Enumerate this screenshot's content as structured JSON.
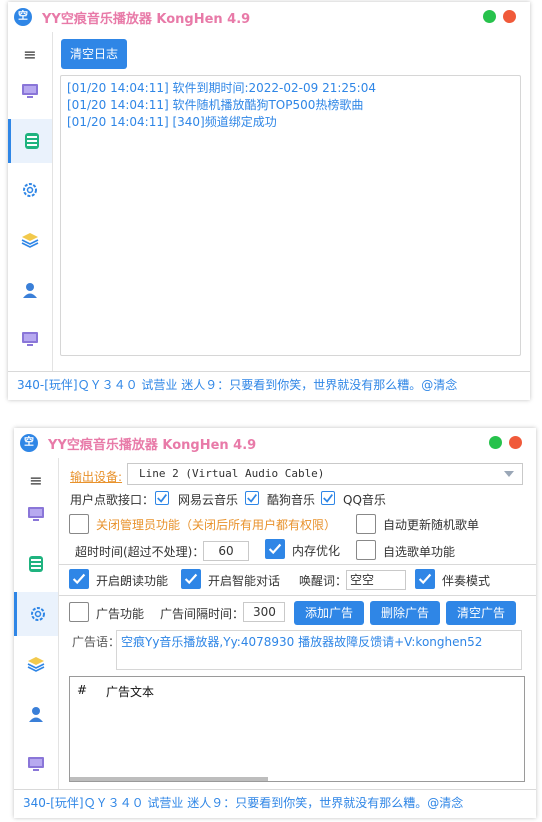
{
  "app": {
    "title": "YY空痕音乐播放器 KongHen 4.9",
    "logo_glyph": "空",
    "accent_color": "#2f86e6",
    "title_color": "#e87aa8"
  },
  "sidebar": {
    "items": [
      {
        "icon": "menu-icon",
        "glyph": "≡"
      },
      {
        "icon": "monitor-icon"
      },
      {
        "icon": "database-icon"
      },
      {
        "icon": "gear-icon"
      },
      {
        "icon": "layers-icon"
      },
      {
        "icon": "user-icon"
      },
      {
        "icon": "monitor-icon"
      }
    ]
  },
  "log_window": {
    "clear_log_button": "清空日志",
    "log_lines": [
      "[01/20 14:04:11] 软件到期时间:2022-02-09 21:25:04",
      "[01/20 14:04:11] 软件随机播放酷狗TOP500热榜歌曲",
      "[01/20 14:04:11] [340]频道绑定成功"
    ]
  },
  "settings_window": {
    "output_device_label": "输出设备:",
    "output_device_value": "Line 2 (Virtual Audio Cable)",
    "song_api_label": "用户点歌接口：",
    "netease_label": "网易云音乐",
    "kugou_label": "酷狗音乐",
    "qq_label": "QQ音乐",
    "close_admin_label": "关闭管理员功能（关闭后所有用户都有权限）",
    "auto_update_label": "自动更新随机歌单",
    "timeout_label": "超时时间(超过不处理)：",
    "timeout_value": "60",
    "memory_opt_label": "内存优化",
    "self_pick_label": "自选歌单功能",
    "read_aloud_label": "开启朗读功能",
    "smart_chat_label": "开启智能对话",
    "wake_word_label": "唤醒词：",
    "wake_word_value": "空空",
    "accompany_label": "伴奏模式",
    "ad_feature_label": "广告功能",
    "ad_interval_label": "广告间隔时间：",
    "ad_interval_value": "300",
    "add_ad_button": "添加广告",
    "delete_ad_button": "删除广告",
    "clear_ad_button": "清空广告",
    "ad_text_label": "广告语：",
    "ad_text_value": "空痕Yy音乐播放器,Yy:4078930 播放器故障反馈请+V:konghen52",
    "table_headers": [
      "#",
      "广告文本"
    ]
  },
  "status_bar": {
    "text": "340-[玩伴]ＱＹ３４０ 试营业 迷人９：只要看到你笑，世界就没有那么糟。@清念"
  }
}
